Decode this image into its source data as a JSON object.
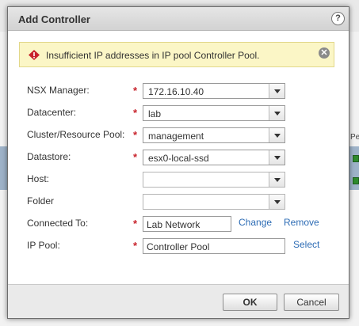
{
  "dialog": {
    "title": "Add Controller",
    "help_glyph": "?"
  },
  "alert": {
    "message": "Insufficient IP addresses in IP pool Controller Pool.",
    "close_glyph": "✕"
  },
  "form": {
    "nsx_manager": {
      "label": "NSX Manager:",
      "value": "172.16.10.40",
      "required": true
    },
    "datacenter": {
      "label": "Datacenter:",
      "value": "lab",
      "required": true
    },
    "cluster_pool": {
      "label": "Cluster/Resource Pool:",
      "value": "management",
      "required": true
    },
    "datastore": {
      "label": "Datastore:",
      "value": "esx0-local-ssd",
      "required": true
    },
    "host": {
      "label": "Host:",
      "value": "",
      "required": false
    },
    "folder": {
      "label": "Folder",
      "value": "",
      "required": false
    },
    "connected_to": {
      "label": "Connected To:",
      "value": "Lab Network",
      "required": true,
      "change_label": "Change",
      "remove_label": "Remove"
    },
    "ip_pool": {
      "label": "IP Pool:",
      "value": "Controller Pool",
      "required": true,
      "select_label": "Select"
    },
    "required_marker": "*"
  },
  "footer": {
    "ok_label": "OK",
    "cancel_label": "Cancel"
  },
  "background": {
    "partial_label": "Pe"
  },
  "colors": {
    "alert_bg": "#fbf6c6",
    "required_marker": "#c8232c",
    "link": "#2d6cb5",
    "status_green": "#2e8b2e"
  }
}
